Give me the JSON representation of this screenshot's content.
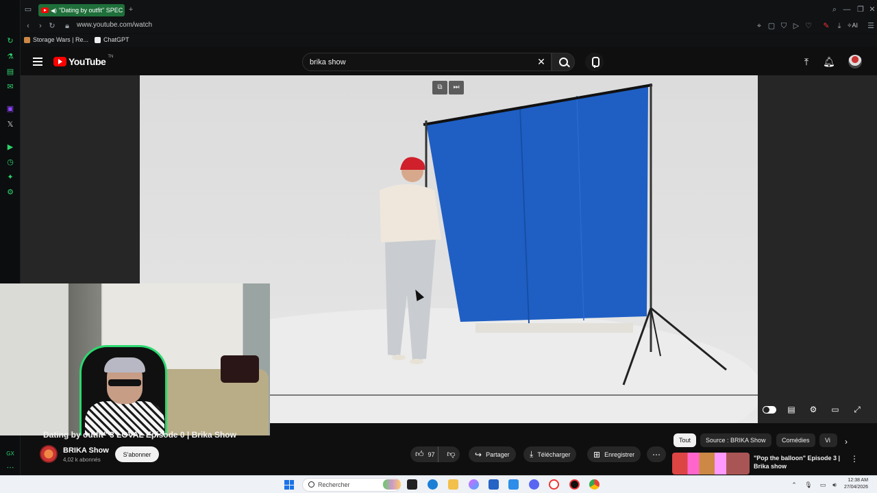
{
  "browser": {
    "tab_title": "\"Dating by outfit\" SPEC",
    "url": "www.youtube.com/watch",
    "bookmarks": [
      {
        "label": "Storage Wars | Re..."
      },
      {
        "label": "ChatGPT"
      }
    ],
    "ai_label": "AI"
  },
  "youtube": {
    "logo_text": "YouTube",
    "logo_suffix": "TN",
    "search_value": "brika show"
  },
  "video": {
    "title": "Dating by outfit\" 3 LOVAL Episode 0 | Brika Show"
  },
  "channel": {
    "name": "BRIKA Show",
    "subscribers": "4,02 k abonnés",
    "subscribe_label": "S'abonner"
  },
  "actions": {
    "like_count": "97",
    "share_label": "Partager",
    "download_label": "Télécharger",
    "save_label": "Enregistrer"
  },
  "chips": [
    {
      "label": "Tout",
      "active": true
    },
    {
      "label": "Source : BRIKA Show",
      "active": false
    },
    {
      "label": "Comédies",
      "active": false
    },
    {
      "label": "Vi",
      "active": false
    }
  ],
  "recommendation": {
    "title": "\"Pop the balloon\" Episode 3 | Brika show"
  },
  "taskbar": {
    "search_placeholder": "Rechercher",
    "time": "12:38 AM",
    "date": "27/04/2026"
  },
  "colors": {
    "accent_gx": "#2fd36d",
    "yt_red": "#ff0000",
    "curtain_blue": "#1f5fc4"
  }
}
